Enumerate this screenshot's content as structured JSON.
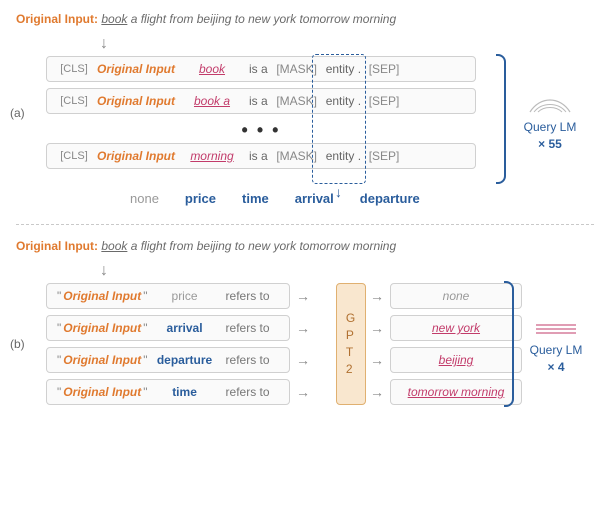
{
  "orig_label": "Original Input:",
  "orig_label_short": "Original Input",
  "sentence_span": "book",
  "sentence_rest": " a flight from beijing to new york tomorrow morning",
  "section_a_label": "(a)",
  "cls": "[CLS]",
  "sep": "[SEP]",
  "mask": "[MASK]",
  "is_a": "is a",
  "entity_dot": "entity .",
  "ellipsis": "• • •",
  "a_rows": [
    {
      "span": "book"
    },
    {
      "span": "book a"
    },
    {
      "span": "morning"
    }
  ],
  "labels": {
    "none": "none",
    "price": "price",
    "time": "time",
    "arrival": "arrival",
    "departure": "departure"
  },
  "query_lm_label": "Query LM",
  "query_a_mult": "× 55",
  "section_b_label": "(b)",
  "refers_to": "refers   to",
  "quote": "\"",
  "gpt_label": "G\nP\nT\n2",
  "b_rows": [
    {
      "slot": "price",
      "slot_gray": true,
      "out": "none",
      "out_none": true
    },
    {
      "slot": "arrival",
      "slot_gray": false,
      "out": "new york",
      "out_none": false
    },
    {
      "slot": "departure",
      "slot_gray": false,
      "out": "beijing",
      "out_none": false
    },
    {
      "slot": "time",
      "slot_gray": false,
      "out": "tomorrow morning",
      "out_none": false
    }
  ],
  "query_b_mult": "× 4"
}
